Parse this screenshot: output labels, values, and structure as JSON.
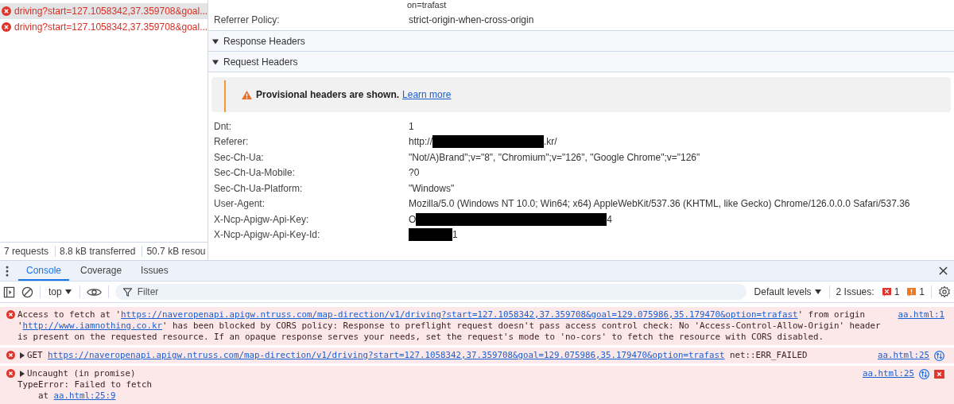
{
  "requests": [
    {
      "name": "driving?start=127.1058342,37.359708&goal...",
      "selected": true
    },
    {
      "name": "driving?start=127.1058342,37.359708&goal...",
      "selected": false
    }
  ],
  "summary": [
    "7 requests",
    "8.8 kB transferred",
    "50.7 kB resou"
  ],
  "cut_value": "on=trafast",
  "general": [
    {
      "name": "Referrer Policy:",
      "value": "strict-origin-when-cross-origin"
    }
  ],
  "sections": [
    {
      "title": "Response Headers",
      "expanded": true
    },
    {
      "title": "Request Headers",
      "expanded": true
    }
  ],
  "notice": {
    "text": "Provisional headers are shown.",
    "link": "Learn more"
  },
  "headers": [
    {
      "name": "Dnt:",
      "value": [
        {
          "kind": "text",
          "text": "1"
        }
      ]
    },
    {
      "name": "Referer:",
      "value": [
        {
          "kind": "text",
          "text": "http://"
        },
        {
          "kind": "redacted"
        },
        {
          "kind": "text",
          "text": ".kr/"
        }
      ]
    },
    {
      "name": "Sec-Ch-Ua:",
      "value": [
        {
          "kind": "text",
          "text": "\"Not/A)Brand\";v=\"8\", \"Chromium\";v=\"126\", \"Google Chrome\";v=\"126\""
        }
      ]
    },
    {
      "name": "Sec-Ch-Ua-Mobile:",
      "value": [
        {
          "kind": "text",
          "text": "?0"
        }
      ]
    },
    {
      "name": "Sec-Ch-Ua-Platform:",
      "value": [
        {
          "kind": "text",
          "text": "\"Windows\""
        }
      ]
    },
    {
      "name": "User-Agent:",
      "value": [
        {
          "kind": "text",
          "text": "Mozilla/5.0 (Windows NT 10.0; Win64; x64) AppleWebKit/537.36 (KHTML, like Gecko) Chrome/126.0.0.0 Safari/537.36"
        }
      ]
    },
    {
      "name": "X-Ncp-Apigw-Api-Key:",
      "value": [
        {
          "kind": "text",
          "text": "O"
        },
        {
          "kind": "redacted"
        },
        {
          "kind": "text",
          "text": "4"
        }
      ]
    },
    {
      "name": "X-Ncp-Apigw-Api-Key-Id:",
      "value": [
        {
          "kind": "redacted"
        },
        {
          "kind": "text",
          "text": "1"
        }
      ]
    }
  ],
  "console": {
    "tabs": [
      {
        "label": "Console",
        "selected": true
      },
      {
        "label": "Coverage",
        "selected": false
      },
      {
        "label": "Issues",
        "selected": false
      }
    ],
    "context": "top",
    "filter_placeholder": "Filter",
    "levels": "Default levels",
    "issues_label": "2 Issues:",
    "issue_counts": [
      {
        "kind": "error",
        "count": "1"
      },
      {
        "kind": "warning",
        "count": "1"
      }
    ],
    "messages": [
      {
        "expandable": false,
        "network_icon": false,
        "issue_icon": false,
        "source": "aa.html:1",
        "lines": [
          [
            {
              "kind": "text",
              "text": "Access to fetch at '"
            },
            {
              "kind": "link",
              "text": "https://naveropenapi.apigw.ntruss.com/map-direction/v1/driving?start=127.1058342,37.359708&goal=129.075986,35.179470&option=trafast"
            },
            {
              "kind": "text",
              "text": "' from origin '"
            },
            {
              "kind": "link",
              "text": "http://www.iamnothing.co.kr"
            },
            {
              "kind": "text",
              "text": "' has been blocked by CORS policy: Response to preflight request doesn't pass access control check: No 'Access-Control-Allow-Origin' header is present on the requested resource. If an opaque response serves your needs, set the request's mode to 'no-cors' to fetch the resource with CORS disabled."
            }
          ]
        ]
      },
      {
        "expandable": true,
        "network_icon": true,
        "issue_icon": false,
        "source": "aa.html:25",
        "lines": [
          [
            {
              "kind": "text",
              "text": "GET "
            },
            {
              "kind": "link",
              "text": "https://naveropenapi.apigw.ntruss.com/map-direction/v1/driving?start=127.1058342,37.359708&goal=129.075986,35.179470&option=trafast"
            },
            {
              "kind": "text",
              "text": " net::ERR_FAILED"
            }
          ]
        ]
      },
      {
        "expandable": true,
        "network_icon": true,
        "issue_icon": true,
        "source": "aa.html:25",
        "lines": [
          [
            {
              "kind": "text",
              "text": "Uncaught (in promise)"
            }
          ],
          [
            {
              "kind": "text",
              "text": "TypeError: Failed to fetch"
            }
          ],
          [
            {
              "kind": "text",
              "text": "    at "
            },
            {
              "kind": "link",
              "text": "aa.html:25:9"
            }
          ]
        ]
      }
    ]
  }
}
